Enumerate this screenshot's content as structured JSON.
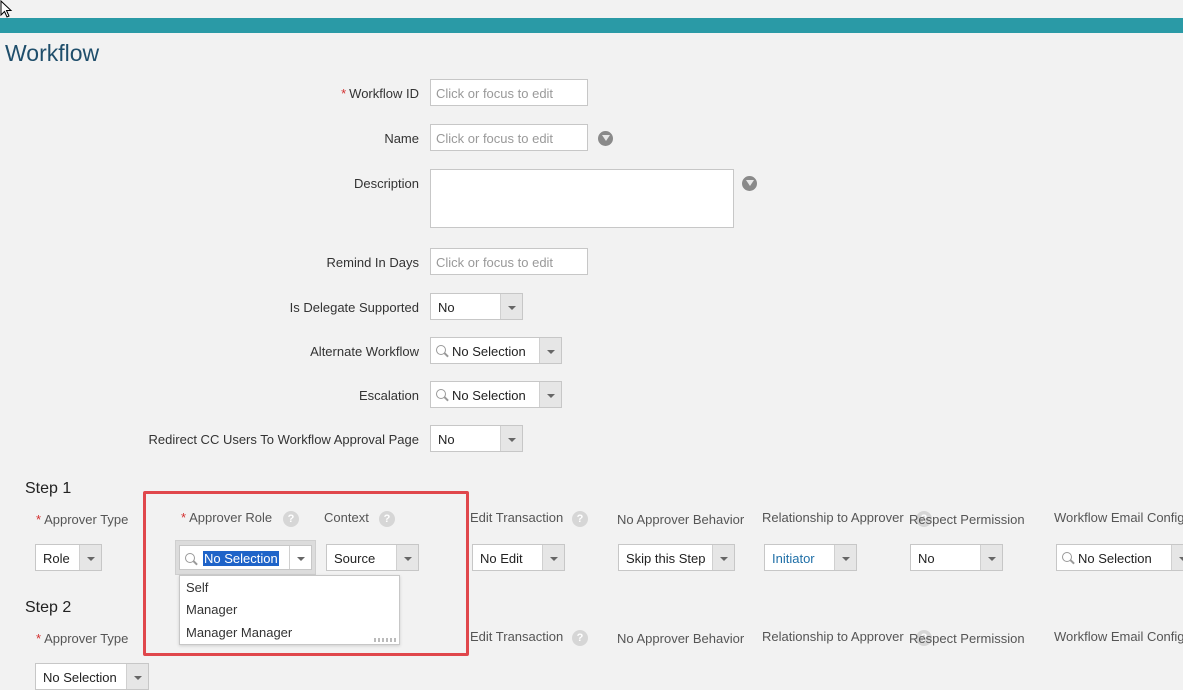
{
  "page": {
    "title": "Workflow"
  },
  "colors": {
    "topbar": "#2a9aa6",
    "title": "#1f4e6b",
    "required": "#d32f2f",
    "highlight": "#e0474c",
    "selection": "#1e63c8"
  },
  "form": {
    "workflow_id": {
      "label": "Workflow ID",
      "required_mark": "*",
      "placeholder": "Click or focus to edit"
    },
    "name": {
      "label": "Name",
      "placeholder": "Click or focus to edit"
    },
    "description": {
      "label": "Description"
    },
    "remind_in_days": {
      "label": "Remind In Days",
      "placeholder": "Click or focus to edit"
    },
    "is_delegate_supported": {
      "label": "Is Delegate Supported",
      "value": "No"
    },
    "alternate_workflow": {
      "label": "Alternate Workflow",
      "value": "No Selection"
    },
    "escalation": {
      "label": "Escalation",
      "value": "No Selection"
    },
    "redirect_cc": {
      "label": "Redirect CC Users To Workflow Approval Page",
      "value": "No"
    }
  },
  "columns": {
    "approver_type": "Approver Type",
    "approver_role": "Approver Role",
    "context": "Context",
    "edit_transaction": "Edit Transaction",
    "no_approver_behavior": "No Approver Behavior",
    "relationship_to_approver": "Relationship to Approver",
    "respect_permission": "Respect Permission",
    "workflow_email_config": "Workflow Email Config",
    "required_mark": "*"
  },
  "step1": {
    "title": "Step 1",
    "approver_type": "Role",
    "approver_role": "No Selection",
    "context": "Source",
    "edit_transaction": "No Edit",
    "no_approver_behavior": "Skip this Step",
    "relationship_to_approver": "Initiator",
    "respect_permission": "No",
    "workflow_email_config": "No Selection"
  },
  "dropdown_options": [
    "Self",
    "Manager",
    "Manager Manager"
  ],
  "step2": {
    "title": "Step 2",
    "approver_type": "No Selection"
  },
  "icons": {
    "help": "question-circle-icon",
    "translate": "globe-icon",
    "search": "search-icon",
    "arrow": "chevron-down-icon"
  }
}
